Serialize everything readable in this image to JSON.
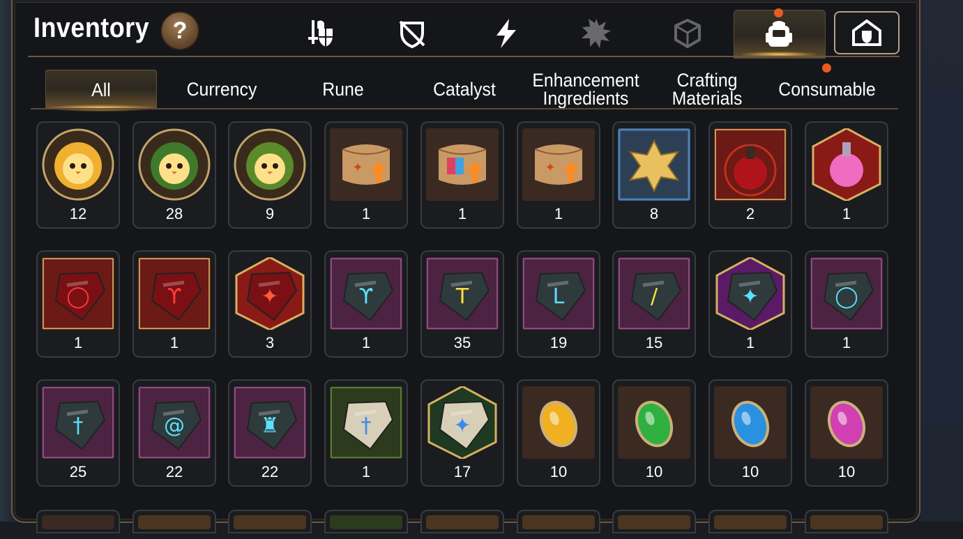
{
  "header": {
    "title": "Inventory",
    "help_label": "?"
  },
  "top_tabs": [
    {
      "icon": "equipment-icon",
      "active": false
    },
    {
      "icon": "shield-broken-icon",
      "active": false
    },
    {
      "icon": "lightning-icon",
      "active": false
    },
    {
      "icon": "burst-icon",
      "active": false
    },
    {
      "icon": "cube-icon",
      "active": false
    },
    {
      "icon": "backpack-icon",
      "active": true,
      "badge": true
    },
    {
      "icon": "house-shield-icon",
      "active": false
    }
  ],
  "category_tabs": [
    {
      "label": "All",
      "active": true
    },
    {
      "label": "Currency"
    },
    {
      "label": "Rune"
    },
    {
      "label": "Catalyst"
    },
    {
      "label": "Enhancement Ingredients"
    },
    {
      "label": "Crafting Materials"
    },
    {
      "label": "Consumable",
      "badge": true
    }
  ],
  "items": [
    {
      "icon": "chick-gold-token-icon",
      "count": "12"
    },
    {
      "icon": "chick-green-token-icon",
      "count": "28"
    },
    {
      "icon": "chick-laurel-token-icon",
      "count": "9"
    },
    {
      "icon": "upgrade-scroll-icon",
      "count": "1"
    },
    {
      "icon": "rainbow-upgrade-scroll-icon",
      "count": "1"
    },
    {
      "icon": "upgrade-scroll-icon",
      "count": "1"
    },
    {
      "icon": "gold-crystal-icon",
      "count": "8"
    },
    {
      "icon": "red-potion-icon",
      "count": "2"
    },
    {
      "icon": "pink-potion-icon",
      "count": "1"
    },
    {
      "icon": "red-rune-ring-icon",
      "count": "1"
    },
    {
      "icon": "red-rune-necklace-icon",
      "count": "1"
    },
    {
      "icon": "red-rune-star-icon",
      "count": "3"
    },
    {
      "icon": "blue-rune-necklace-icon",
      "count": "1"
    },
    {
      "icon": "yellow-rune-hammer-icon",
      "count": "35"
    },
    {
      "icon": "blue-rune-boot-icon",
      "count": "19"
    },
    {
      "icon": "yellow-rune-slash-icon",
      "count": "15"
    },
    {
      "icon": "blue-rune-star-icon",
      "count": "1"
    },
    {
      "icon": "blue-rune-ring-icon",
      "count": "1"
    },
    {
      "icon": "blue-rune-sword-icon",
      "count": "25"
    },
    {
      "icon": "blue-rune-helmet-icon",
      "count": "22"
    },
    {
      "icon": "blue-rune-armor-icon",
      "count": "22"
    },
    {
      "icon": "stone-sword-rune-icon",
      "count": "1"
    },
    {
      "icon": "stone-star-rune-icon",
      "count": "17"
    },
    {
      "icon": "yellow-gem-icon",
      "count": "10"
    },
    {
      "icon": "green-gem-icon",
      "count": "10"
    },
    {
      "icon": "blue-gem-icon",
      "count": "10"
    },
    {
      "icon": "pink-gem-icon",
      "count": "10"
    }
  ],
  "colors": {
    "accent": "#f0a840",
    "badge": "#e85c1e",
    "border": "#6a5a44"
  }
}
